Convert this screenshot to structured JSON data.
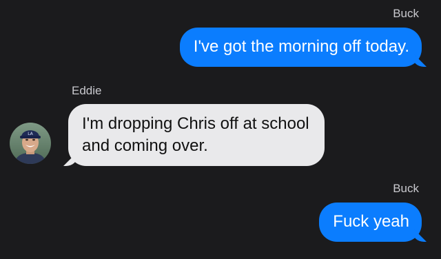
{
  "messages": [
    {
      "sender": "Buck",
      "direction": "outgoing",
      "text": "I've got the morning off today."
    },
    {
      "sender": "Eddie",
      "direction": "incoming",
      "lines": [
        "I'm dropping Chris off at school",
        "and coming over."
      ],
      "avatar": "contact-photo"
    },
    {
      "sender": "Buck",
      "direction": "outgoing",
      "text": "Fuck yeah"
    }
  ],
  "colors": {
    "background": "#1b1b1d",
    "outgoing_bubble": "#0b7dfe",
    "incoming_bubble": "#e9e9eb",
    "sender_label": "#c9c9ce"
  }
}
